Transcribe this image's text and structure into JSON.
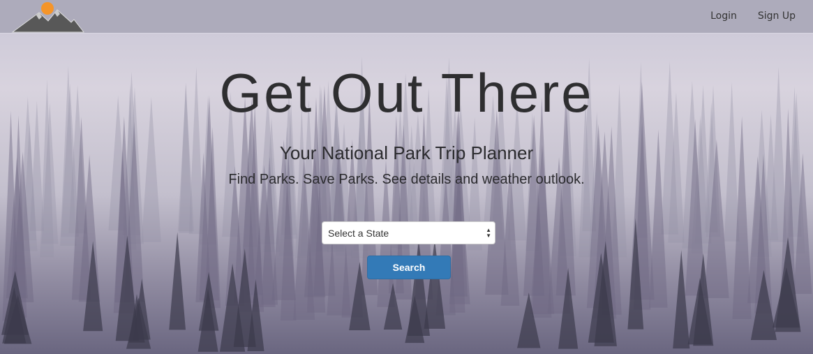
{
  "nav": {
    "login": "Login",
    "signup": "Sign Up"
  },
  "hero": {
    "title": "Get Out There",
    "subtitle": "Your National Park Trip Planner",
    "tagline": "Find Parks. Save Parks. See details and weather outlook."
  },
  "form": {
    "state_select": "Select a State",
    "search_label": "Search"
  },
  "colors": {
    "accent": "#337ab7",
    "sun": "#f5952a",
    "mountain": "#555555"
  },
  "icons": {
    "logo": "mountain-sun-logo",
    "select": "up-down-arrows-icon"
  }
}
